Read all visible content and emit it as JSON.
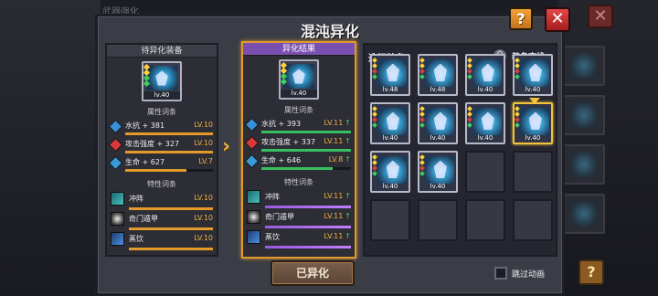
{
  "background": {
    "title_fragment": "武器强化",
    "close_label": "✕",
    "help_label": "?"
  },
  "dialog": {
    "title": "混沌异化",
    "help_label": "?",
    "close_label": "✕"
  },
  "left_panel": {
    "header": "待异化装备",
    "item": {
      "level": "lv.40"
    },
    "attr_title": "属性词条",
    "stats": [
      {
        "name": "水抗 + 381",
        "level": "LV.10",
        "fill": 1.0,
        "icon": "water-shield-icon"
      },
      {
        "name": "攻击强度 + 327",
        "level": "LV.10",
        "fill": 1.0,
        "icon": "attack-icon"
      },
      {
        "name": "生命 + 627",
        "level": "LV.7",
        "fill": 0.7,
        "icon": "life-icon"
      }
    ],
    "trait_title": "特性词条",
    "traits": [
      {
        "name": "冲阵",
        "level": "LV.10",
        "icon": "dash-icon"
      },
      {
        "name": "奇门遁甲",
        "level": "LV.10",
        "icon": "armor-icon"
      },
      {
        "name": "蒸饮",
        "level": "LV.10",
        "icon": "drink-icon"
      }
    ]
  },
  "mid_panel": {
    "header": "异化结果",
    "item": {
      "level": "lv.40"
    },
    "attr_title": "属性词条",
    "stats": [
      {
        "name": "水抗 + 393",
        "level": "LV.11",
        "arrow": "↑",
        "fill": 1.0
      },
      {
        "name": "攻击强度 + 337",
        "level": "LV.11",
        "arrow": "↑",
        "fill": 1.0
      },
      {
        "name": "生命 + 646",
        "level": "LV.8",
        "arrow": "↑",
        "fill": 0.8
      }
    ],
    "trait_title": "特性词条",
    "traits": [
      {
        "name": "冲阵",
        "level": "LV.11",
        "arrow": "↑"
      },
      {
        "name": "奇门遁甲",
        "level": "LV.11",
        "arrow": "↑"
      },
      {
        "name": "蒸饮",
        "level": "LV.11",
        "arrow": "↑"
      }
    ]
  },
  "right_panel": {
    "title": "选择装备",
    "search_label": "装备查找",
    "slots": [
      {
        "level": "lv.48",
        "filled": true,
        "selected": false
      },
      {
        "level": "lv.48",
        "filled": true,
        "selected": false
      },
      {
        "level": "lv.40",
        "filled": true,
        "selected": false
      },
      {
        "level": "lv.40",
        "filled": true,
        "selected": false
      },
      {
        "level": "lv.40",
        "filled": true,
        "selected": false
      },
      {
        "level": "lv.40",
        "filled": true,
        "selected": false
      },
      {
        "level": "lv.40",
        "filled": true,
        "selected": false
      },
      {
        "level": "lv.40",
        "filled": true,
        "selected": true
      },
      {
        "level": "lv.40",
        "filled": true,
        "selected": false
      },
      {
        "level": "lv.40",
        "filled": true,
        "selected": false
      },
      {
        "level": "",
        "filled": false,
        "selected": false
      },
      {
        "level": "",
        "filled": false,
        "selected": false
      },
      {
        "level": "",
        "filled": false,
        "selected": false
      },
      {
        "level": "",
        "filled": false,
        "selected": false
      },
      {
        "level": "",
        "filled": false,
        "selected": false
      },
      {
        "level": "",
        "filled": false,
        "selected": false
      }
    ]
  },
  "footer": {
    "done_label": "已异化",
    "skip_label": "跳过动画",
    "skip_checked": false
  },
  "arrow_glyph": "›"
}
